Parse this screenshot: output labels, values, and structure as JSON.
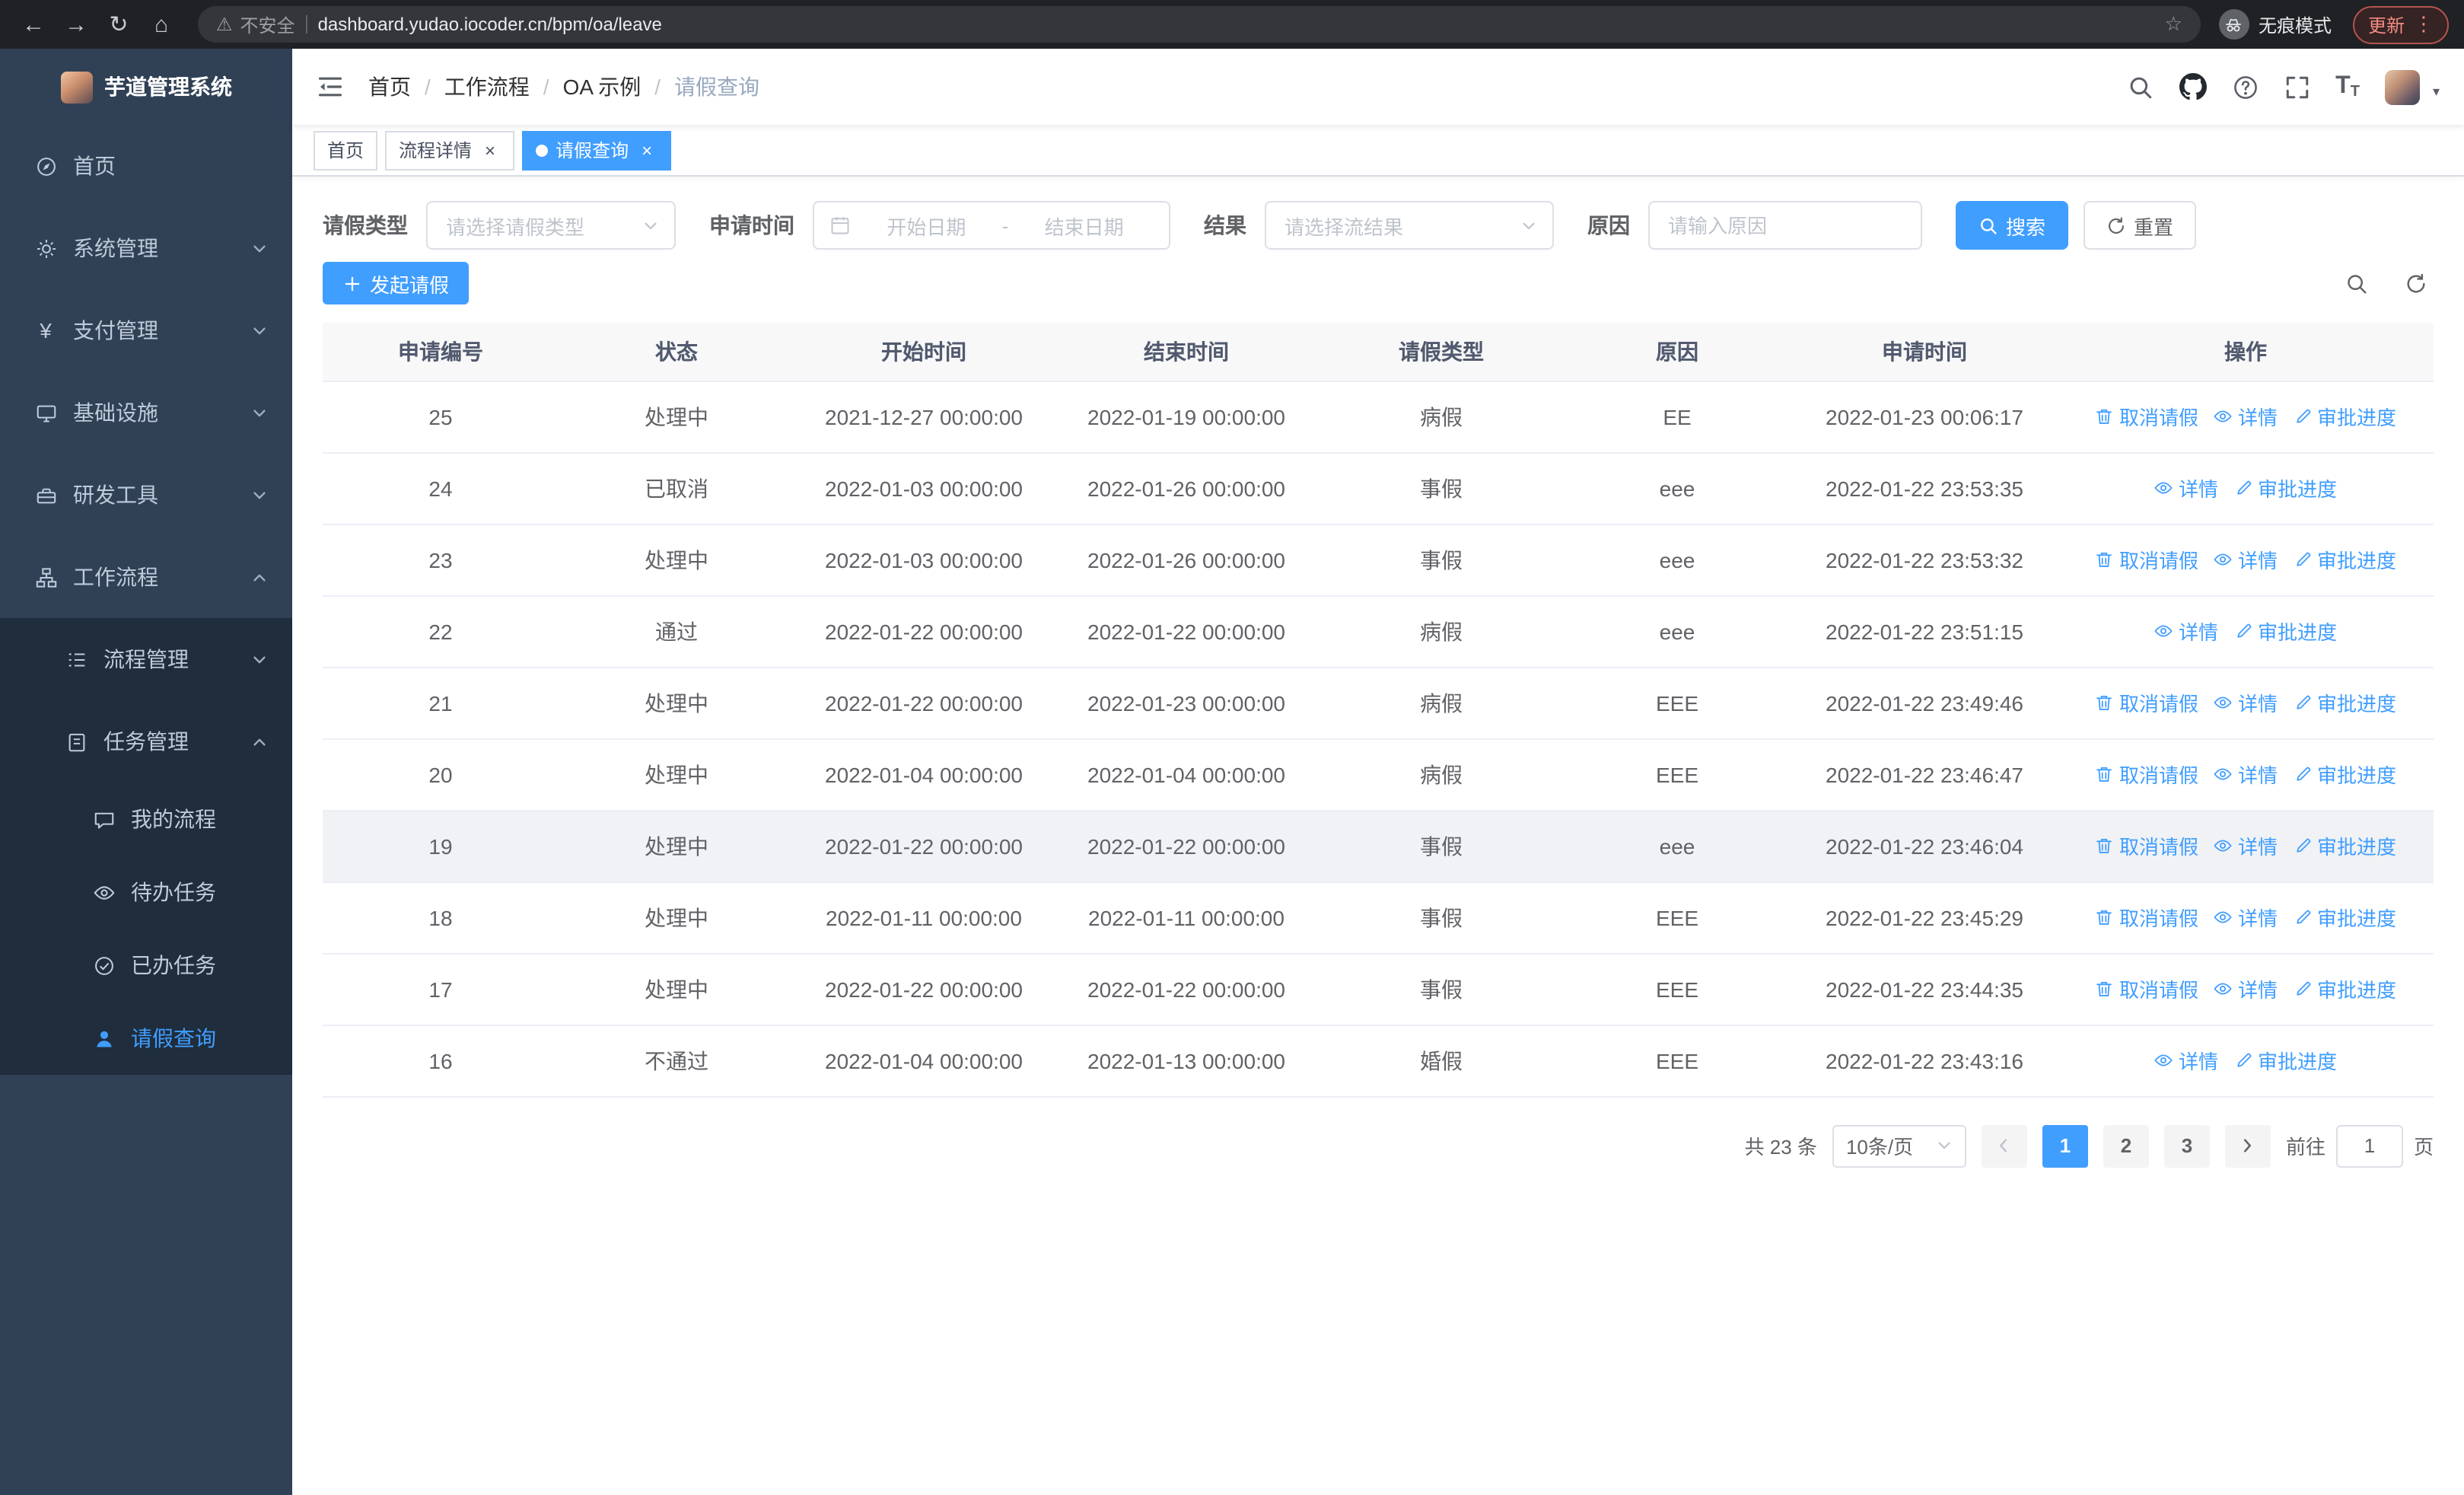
{
  "browser": {
    "security_label": "不安全",
    "url": "dashboard.yudao.iocoder.cn/bpm/oa/leave",
    "incognito_label": "无痕模式",
    "update_label": "更新"
  },
  "icons": {
    "back": "←",
    "forward": "→",
    "reload": "↻",
    "home": "⌂",
    "warning": "⚠",
    "star": "☆",
    "more": "⋮",
    "caret_down": "▾",
    "close": "×",
    "yen": "¥",
    "text_size": "T",
    "breadcrumb_separator": "/"
  },
  "sidebar": {
    "logo_title": "芋道管理系统",
    "items": [
      {
        "label": "首页"
      },
      {
        "label": "系统管理"
      },
      {
        "label": "支付管理"
      },
      {
        "label": "基础设施"
      },
      {
        "label": "研发工具"
      },
      {
        "label": "工作流程"
      }
    ],
    "workflow_children": [
      {
        "label": "流程管理"
      },
      {
        "label": "任务管理"
      }
    ],
    "task_children": [
      {
        "label": "我的流程"
      },
      {
        "label": "待办任务"
      },
      {
        "label": "已办任务"
      },
      {
        "label": "请假查询"
      }
    ]
  },
  "header": {
    "breadcrumb": [
      "首页",
      "工作流程",
      "OA 示例",
      "请假查询"
    ]
  },
  "tabs": [
    {
      "label": "首页"
    },
    {
      "label": "流程详情"
    },
    {
      "label": "请假查询"
    }
  ],
  "filters": {
    "leave_type_label": "请假类型",
    "leave_type_placeholder": "请选择请假类型",
    "apply_time_label": "申请时间",
    "start_date_placeholder": "开始日期",
    "date_separator": "-",
    "end_date_placeholder": "结束日期",
    "result_label": "结果",
    "result_placeholder": "请选择流结果",
    "reason_label": "原因",
    "reason_placeholder": "请输入原因",
    "search_button": "搜索",
    "reset_button": "重置"
  },
  "toolbar": {
    "create_button": "发起请假"
  },
  "table": {
    "columns": [
      "申请编号",
      "状态",
      "开始时间",
      "结束时间",
      "请假类型",
      "原因",
      "申请时间",
      "操作"
    ],
    "actions": {
      "cancel": "取消请假",
      "detail": "详情",
      "progress": "审批进度"
    },
    "rows": [
      {
        "id": "25",
        "status": "处理中",
        "start": "2021-12-27 00:00:00",
        "end": "2022-01-19 00:00:00",
        "type": "病假",
        "reason": "EE",
        "apply_time": "2022-01-23 00:06:17",
        "cancellable": true,
        "hover": false
      },
      {
        "id": "24",
        "status": "已取消",
        "start": "2022-01-03 00:00:00",
        "end": "2022-01-26 00:00:00",
        "type": "事假",
        "reason": "eee",
        "apply_time": "2022-01-22 23:53:35",
        "cancellable": false,
        "hover": false
      },
      {
        "id": "23",
        "status": "处理中",
        "start": "2022-01-03 00:00:00",
        "end": "2022-01-26 00:00:00",
        "type": "事假",
        "reason": "eee",
        "apply_time": "2022-01-22 23:53:32",
        "cancellable": true,
        "hover": false
      },
      {
        "id": "22",
        "status": "通过",
        "start": "2022-01-22 00:00:00",
        "end": "2022-01-22 00:00:00",
        "type": "病假",
        "reason": "eee",
        "apply_time": "2022-01-22 23:51:15",
        "cancellable": false,
        "hover": false
      },
      {
        "id": "21",
        "status": "处理中",
        "start": "2022-01-22 00:00:00",
        "end": "2022-01-23 00:00:00",
        "type": "病假",
        "reason": "EEE",
        "apply_time": "2022-01-22 23:49:46",
        "cancellable": true,
        "hover": false
      },
      {
        "id": "20",
        "status": "处理中",
        "start": "2022-01-04 00:00:00",
        "end": "2022-01-04 00:00:00",
        "type": "病假",
        "reason": "EEE",
        "apply_time": "2022-01-22 23:46:47",
        "cancellable": true,
        "hover": false
      },
      {
        "id": "19",
        "status": "处理中",
        "start": "2022-01-22 00:00:00",
        "end": "2022-01-22 00:00:00",
        "type": "事假",
        "reason": "eee",
        "apply_time": "2022-01-22 23:46:04",
        "cancellable": true,
        "hover": true
      },
      {
        "id": "18",
        "status": "处理中",
        "start": "2022-01-11 00:00:00",
        "end": "2022-01-11 00:00:00",
        "type": "事假",
        "reason": "EEE",
        "apply_time": "2022-01-22 23:45:29",
        "cancellable": true,
        "hover": false
      },
      {
        "id": "17",
        "status": "处理中",
        "start": "2022-01-22 00:00:00",
        "end": "2022-01-22 00:00:00",
        "type": "事假",
        "reason": "EEE",
        "apply_time": "2022-01-22 23:44:35",
        "cancellable": true,
        "hover": false
      },
      {
        "id": "16",
        "status": "不通过",
        "start": "2022-01-04 00:00:00",
        "end": "2022-01-13 00:00:00",
        "type": "婚假",
        "reason": "EEE",
        "apply_time": "2022-01-22 23:43:16",
        "cancellable": false,
        "hover": false
      }
    ]
  },
  "pagination": {
    "total_text": "共 23 条",
    "page_size": "10条/页",
    "pages": [
      "1",
      "2",
      "3"
    ],
    "active_page": "1",
    "goto_label": "前往",
    "goto_value": "1",
    "goto_suffix": "页"
  },
  "colors": {
    "primary": "#409eff",
    "sidebar_bg": "#304156",
    "sidebar_submenu_bg": "#1f2d3d",
    "link": "#409eff",
    "update_chip": "#f28b82"
  }
}
